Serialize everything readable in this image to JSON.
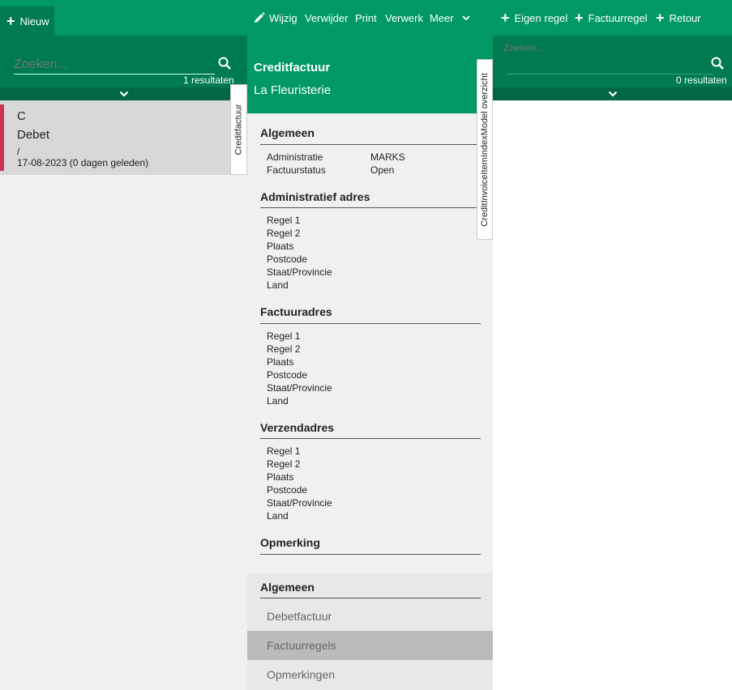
{
  "toolbar": {
    "nieuw": "Nieuw",
    "wijzig": "Wijzig",
    "verwijder": "Verwijder",
    "print": "Print",
    "verwerk": "Verwerk",
    "meer": "Meer",
    "eigen_regel": "Eigen regel",
    "factuurregel": "Factuurregel",
    "retour": "Retour"
  },
  "left": {
    "search_placeholder": "Zoeken...",
    "result_count": "1 resultaten",
    "items": [
      {
        "title": "C",
        "subtitle": "Debet",
        "line": "/",
        "date": "17-08-2023 (0 dagen geleden)"
      }
    ],
    "vertical_tab": "Creditfactuur"
  },
  "middle": {
    "title": "Creditfactuur",
    "subtitle": "La Fleuristerie",
    "vertical_tab": "CreditInvoiceItemIndexModel overzicht",
    "algemeen": {
      "title": "Algemeen",
      "rows": [
        {
          "label": "Administratie",
          "value": "MARKS"
        },
        {
          "label": "Factuurstatus",
          "value": "Open"
        }
      ]
    },
    "admin_adres": {
      "title": "Administratief adres",
      "rows": [
        "Regel 1",
        "Regel 2",
        "Plaats",
        "Postcode",
        "Staat/Provincie",
        "Land"
      ]
    },
    "factuuradres": {
      "title": "Factuuradres",
      "rows": [
        "Regel 1",
        "Regel 2",
        "Plaats",
        "Postcode",
        "Staat/Provincie",
        "Land"
      ]
    },
    "verzendadres": {
      "title": "Verzendadres",
      "rows": [
        "Regel 1",
        "Regel 2",
        "Plaats",
        "Postcode",
        "Staat/Provincie",
        "Land"
      ]
    },
    "opmerking": {
      "title": "Opmerking"
    },
    "nav": {
      "title": "Algemeen",
      "items": [
        "Debetfactuur",
        "Factuurregels",
        "Opmerkingen"
      ]
    }
  },
  "right": {
    "search_placeholder": "Zoeken...",
    "result_count": "0 resultaten"
  },
  "colors": {
    "brand": "#009966",
    "brand_dark": "#007a50",
    "accent_bar": "#cc3355",
    "selected_nav": "#bbbbbb"
  }
}
